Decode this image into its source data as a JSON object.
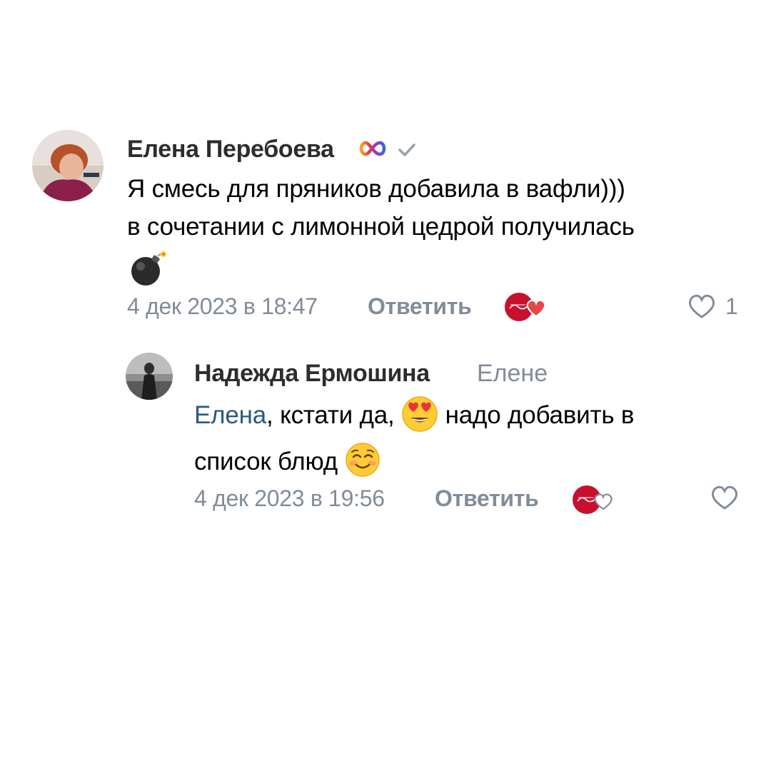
{
  "comments": [
    {
      "author": "Елена Перебоева",
      "badge_icon": "infinity-badge-icon",
      "verified_icon": "checkmark-icon",
      "lines": [
        "Я смесь для пряников добавила в вафли)))",
        "в сочетании с лимонной цедрой получилась"
      ],
      "trailing_emoji": "bomb-emoji-icon",
      "date": "4 дек 2023 в 18:47",
      "reply_label": "Ответить",
      "reaction_icon": "author-heart-reaction-icon",
      "like_icon": "heart-outline-icon",
      "likes": "1"
    },
    {
      "author": "Надежда Ермошина",
      "reply_to": "Елене",
      "mention": "Елена",
      "text_part1": ", кстати да, ",
      "emoji1": "heart-eyes-emoji-icon",
      "text_part2": " надо добавить в",
      "text_line2": "список блюд ",
      "emoji2": "smiling-blush-emoji-icon",
      "date": "4 дек 2023 в 19:56",
      "reply_label": "Ответить",
      "reaction_icon": "author-heart-reaction-icon",
      "like_icon": "heart-outline-icon"
    }
  ],
  "colors": {
    "text": "#000000",
    "name": "#2c2d2e",
    "secondary": "#818c99",
    "link": "#2a5885",
    "brand_red": "#c8102e",
    "heart_red": "#e64646"
  }
}
